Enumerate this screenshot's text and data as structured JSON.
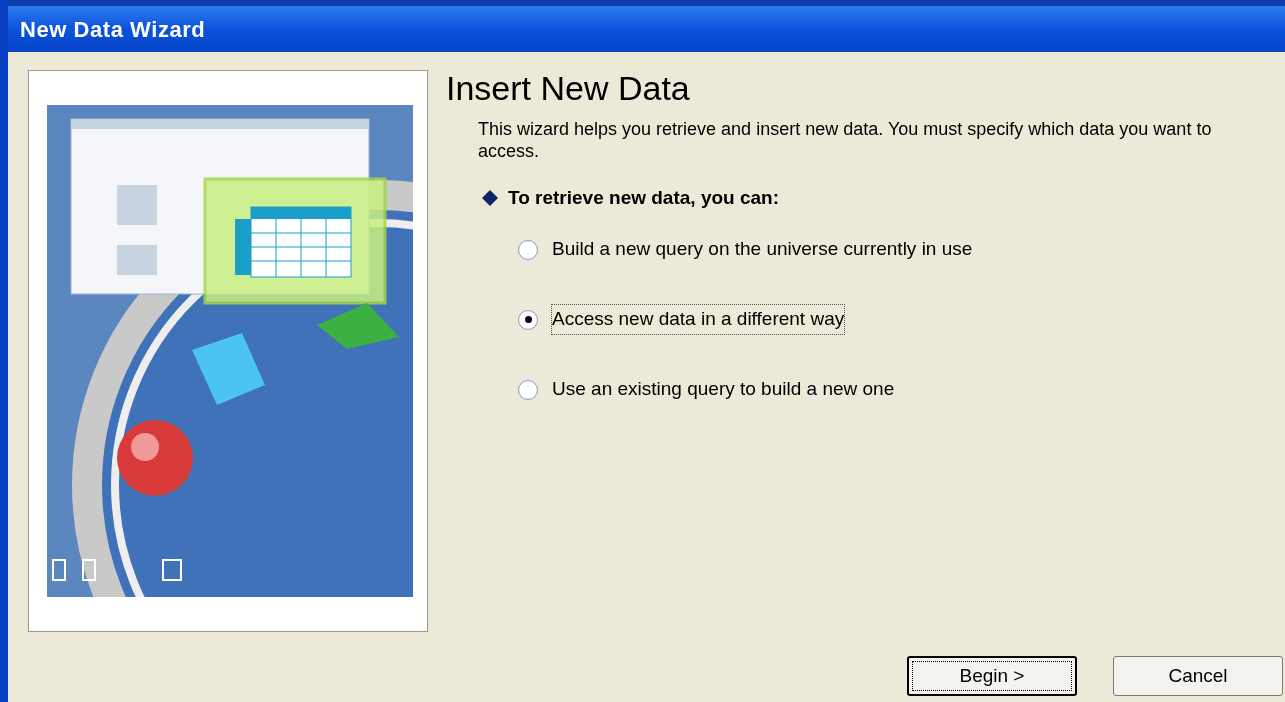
{
  "window": {
    "title": "New Data Wizard"
  },
  "heading": "Insert New Data",
  "description": "This wizard helps you retrieve and insert new data. You must specify which data you want to access.",
  "section_label": "To retrieve new data, you can:",
  "options": [
    {
      "label": "Build a new query on the universe currently in use",
      "selected": false
    },
    {
      "label": "Access new data in a different way",
      "selected": true
    },
    {
      "label": "Use an existing query to build a new one",
      "selected": false
    }
  ],
  "buttons": [
    {
      "label": "Begin >",
      "default": true
    },
    {
      "label": "Cancel",
      "default": false
    }
  ]
}
